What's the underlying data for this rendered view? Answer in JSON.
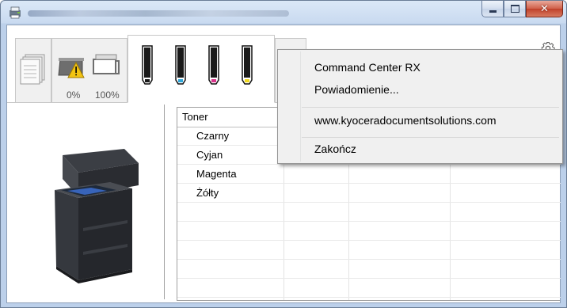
{
  "titlebar": {
    "app_icon": "printer-app-icon",
    "buttons": {
      "minimize": "minimize-icon",
      "maximize": "maximize-icon",
      "close": "close-icon"
    }
  },
  "tabs": {
    "paper_levels": [
      "0%",
      "100%"
    ],
    "toner_colors": [
      "#1a1a1a",
      "#2fa6d8",
      "#d8338a",
      "#f0d820"
    ]
  },
  "settings_icon": "gear-icon",
  "table": {
    "headers": [
      "Toner",
      "",
      "",
      ""
    ],
    "rows": [
      "Czarny",
      "Cyjan",
      "Magenta",
      "Żółty",
      "",
      "",
      "",
      "",
      ""
    ]
  },
  "context_menu": {
    "items": [
      {
        "label": "Command Center RX"
      },
      {
        "label": "Powiadomienie..."
      },
      {
        "label": "www.kyoceradocumentsolutions.com"
      },
      {
        "label": "Zakończ"
      }
    ]
  }
}
